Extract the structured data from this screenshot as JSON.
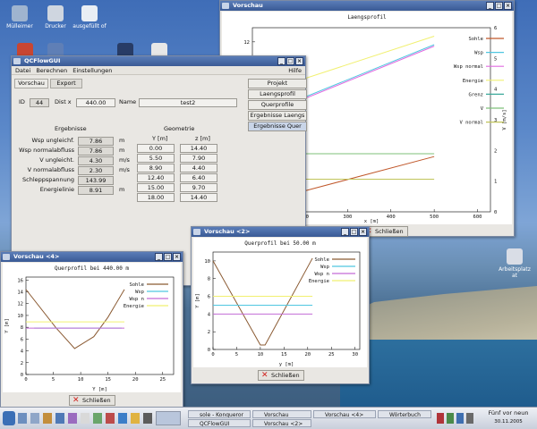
{
  "desktop": {
    "icons": [
      "Mülleimer",
      "Drucker",
      "ausgefüllt\nof",
      "Arbeitsplatz\nat"
    ]
  },
  "vorschau_main": {
    "title": "Vorschau",
    "close_label": "Schließen",
    "chart_data": {
      "type": "line",
      "title": "Laengsprofil",
      "xlabel": "x [m]",
      "ylabel": "V [m/s]",
      "x_ticks": [
        "200",
        "300",
        "400",
        "500",
        "600"
      ],
      "y_left_ticks": [
        "0",
        "2",
        "4",
        "6",
        "8",
        "10",
        "12"
      ],
      "y_right_ticks": [
        "0",
        "1",
        "2",
        "3",
        "4",
        "5",
        "6"
      ],
      "series": [
        {
          "name": "Sohle",
          "color": "#c0572a",
          "x": [
            80,
            500
          ],
          "y": [
            0.5,
            3.9
          ]
        },
        {
          "name": "Wsp",
          "color": "#4fc6e0",
          "x": [
            80,
            500
          ],
          "y": [
            6.6,
            11.8
          ]
        },
        {
          "name": "Wsp normal",
          "color": "#e16be0",
          "x": [
            80,
            500
          ],
          "y": [
            6.5,
            11.7
          ]
        },
        {
          "name": "Energie",
          "color": "#f1f070",
          "x": [
            80,
            500
          ],
          "y": [
            8.2,
            12.4
          ]
        },
        {
          "name": "Grenz",
          "color": "#3aa89a",
          "x": [],
          "y": []
        },
        {
          "name": "V",
          "color": "#7fc07a",
          "x": [
            80,
            500
          ],
          "y": [
            4.1,
            4.1
          ]
        },
        {
          "name": "V normal",
          "color": "#c0c45a",
          "x": [
            80,
            500
          ],
          "y": [
            2.3,
            2.3
          ]
        }
      ]
    }
  },
  "app": {
    "title": "QCFlowGUI",
    "menu": [
      "Datei",
      "Berechnen",
      "Einstellungen"
    ],
    "help": "Hilfe",
    "tabs": [
      "Vorschau",
      "Export"
    ],
    "id_label": "ID",
    "id_value": "44",
    "dist_label": "Dist x",
    "dist_value": "440.00",
    "name_label": "Name",
    "name_value": "test2",
    "ergebnisse_title": "Ergebnisse",
    "geometrie_title": "Geometrie",
    "results": [
      {
        "label": "Wsp ungleichf.",
        "value": "7.86",
        "unit": "m"
      },
      {
        "label": "Wsp normalabfluss",
        "value": "7.86",
        "unit": "m"
      },
      {
        "label": "V ungleicht.",
        "value": "4.30",
        "unit": "m/s"
      },
      {
        "label": "V normalabfluss",
        "value": "2.30",
        "unit": "m/s"
      },
      {
        "label": "Schleppspannung",
        "value": "143.99",
        "unit": ""
      },
      {
        "label": "Energielinie",
        "value": "8.91",
        "unit": "m"
      }
    ],
    "geo_headers": [
      "Y [m]",
      "z [m]"
    ],
    "geo_rows": [
      [
        "0.00",
        "14.40"
      ],
      [
        "5.50",
        "7.90"
      ],
      [
        "8.90",
        "4.40"
      ],
      [
        "12.40",
        "6.40"
      ],
      [
        "15.00",
        "9.70"
      ],
      [
        "18.00",
        "14.40"
      ]
    ],
    "buttons": [
      "Projekt",
      "Laengsprofil",
      "Querprofile",
      "Ergebnisse Laengs",
      "Ergebnisse Quer"
    ]
  },
  "vorschau4": {
    "title": "Vorschau <4>",
    "close_label": "Schließen",
    "chart_data": {
      "type": "line",
      "title": "Querprofil bei    440.00 m",
      "xlabel": "Y [m]",
      "ylabel": "Y [m]",
      "x_ticks": [
        "0",
        "5",
        "10",
        "15",
        "20",
        "25"
      ],
      "y_ticks": [
        "0",
        "2",
        "4",
        "6",
        "8",
        "10",
        "12",
        "14",
        "16"
      ],
      "series": [
        {
          "name": "Sohle",
          "color": "#8a5a32",
          "x": [
            0,
            5.5,
            8.9,
            12.4,
            15,
            18
          ],
          "y": [
            14.4,
            7.9,
            4.4,
            6.4,
            9.7,
            14.4
          ]
        },
        {
          "name": "Wsp",
          "color": "#4fc6e0",
          "x": [
            1.5,
            17.5
          ],
          "y": [
            7.86,
            7.86
          ]
        },
        {
          "name": "Wsp n",
          "color": "#c36bd6",
          "x": [
            0,
            18
          ],
          "y": [
            7.86,
            7.86
          ]
        },
        {
          "name": "Energie",
          "color": "#f1f070",
          "x": [
            0,
            18
          ],
          "y": [
            8.91,
            8.91
          ]
        }
      ]
    }
  },
  "vorschau2": {
    "title": "Vorschau <2>",
    "close_label": "Schließen",
    "chart_data": {
      "type": "line",
      "title": "Querprofil bei     50.00 m",
      "xlabel": "y [m]",
      "ylabel": "Y [m]",
      "x_ticks": [
        "0",
        "5",
        "10",
        "15",
        "20",
        "25",
        "30"
      ],
      "y_ticks": [
        "0",
        "2",
        "4",
        "6",
        "8",
        "10"
      ],
      "series": [
        {
          "name": "Sohle",
          "color": "#8a5a32",
          "x": [
            0,
            10,
            11,
            21
          ],
          "y": [
            10,
            0.5,
            0.5,
            10.3
          ]
        },
        {
          "name": "Wsp",
          "color": "#4fc6e0",
          "x": [
            0,
            21
          ],
          "y": [
            5,
            5
          ]
        },
        {
          "name": "Wsp n",
          "color": "#c36bd6",
          "x": [
            0,
            21
          ],
          "y": [
            4,
            4
          ]
        },
        {
          "name": "Energie",
          "color": "#f1f070",
          "x": [
            0,
            21
          ],
          "y": [
            6,
            6
          ]
        }
      ]
    }
  },
  "taskbar": {
    "items": [
      "sole - Konqueror",
      "QCFlowGUI",
      "Vorschau",
      "Vorschau <2>",
      "Vorschau <4>",
      "Wörterbuch"
    ],
    "clock": "Fünf vor neun",
    "date": "30.11.2005"
  }
}
